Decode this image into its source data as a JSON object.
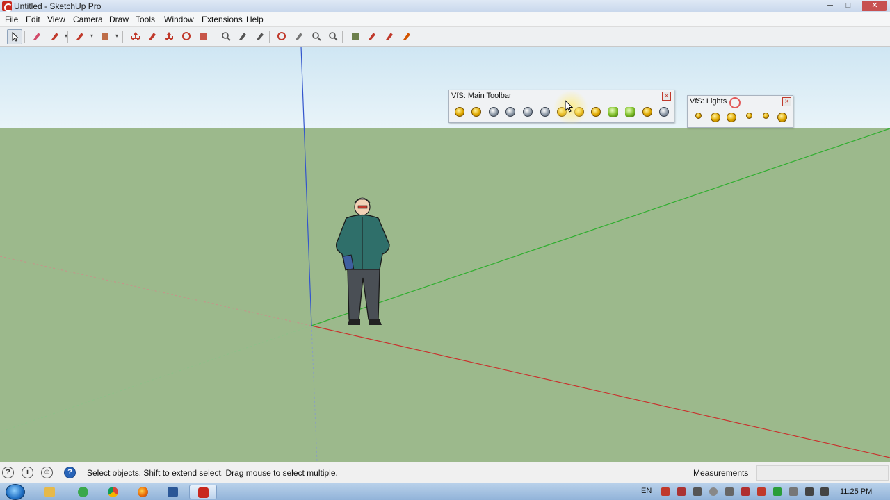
{
  "window": {
    "title": "Untitled - SketchUp Pro",
    "min_label": "─",
    "max_label": "□",
    "close_label": "✕"
  },
  "menu": [
    "File",
    "Edit",
    "View",
    "Camera",
    "Draw",
    "Tools",
    "Window",
    "Extensions",
    "Help"
  ],
  "toolbar": {
    "tools": [
      {
        "name": "select-icon",
        "color": "#222222"
      },
      {
        "name": "eraser-icon",
        "color": "#d24a6a"
      },
      {
        "name": "pencil-icon",
        "color": "#c0392b"
      },
      {
        "name": "arc-icon",
        "color": "#c0392b"
      },
      {
        "name": "rectangle-icon",
        "color": "#b5562c"
      },
      {
        "name": "push-pull-icon",
        "color": "#c0392b"
      },
      {
        "name": "follow-me-icon",
        "color": "#c0392b"
      },
      {
        "name": "move-icon",
        "color": "#c0392b"
      },
      {
        "name": "rotate-icon",
        "color": "#c0392b"
      },
      {
        "name": "scale-icon",
        "color": "#c0392b"
      },
      {
        "name": "tape-measure-icon",
        "color": "#555555"
      },
      {
        "name": "text-icon",
        "color": "#555555"
      },
      {
        "name": "paint-bucket-icon",
        "color": "#555555"
      },
      {
        "name": "orbit-icon",
        "color": "#c0392b"
      },
      {
        "name": "pan-icon",
        "color": "#777777"
      },
      {
        "name": "zoom-icon",
        "color": "#555555"
      },
      {
        "name": "zoom-extents-icon",
        "color": "#555555"
      },
      {
        "name": "warehouse-icon",
        "color": "#556b2f"
      },
      {
        "name": "share-model-icon",
        "color": "#c0392b"
      },
      {
        "name": "share-component-icon",
        "color": "#c0392b"
      },
      {
        "name": "extension-warehouse-icon",
        "color": "#d35400"
      }
    ]
  },
  "vfs_main": {
    "title": "VfS: Main Toolbar",
    "icons": [
      {
        "name": "vray-options-icon",
        "kind": "gold"
      },
      {
        "name": "material-editor-icon",
        "kind": "gold"
      },
      {
        "name": "render-icon",
        "kind": "grey"
      },
      {
        "name": "render-rt-icon",
        "kind": "grey"
      },
      {
        "name": "batch-render-icon",
        "kind": "grey"
      },
      {
        "name": "help-icon",
        "kind": "grey"
      },
      {
        "name": "frame-buffer-icon",
        "kind": "gold"
      },
      {
        "name": "light-gen-icon",
        "kind": "gold"
      },
      {
        "name": "export-icon",
        "kind": "gold"
      },
      {
        "name": "proxy-import-icon",
        "kind": "green"
      },
      {
        "name": "proxy-export-icon",
        "kind": "green"
      },
      {
        "name": "infinite-plane-icon",
        "kind": "gold"
      },
      {
        "name": "pause-icon",
        "kind": "grey"
      }
    ]
  },
  "vfs_lights": {
    "title": "VfS: Lights",
    "icons": [
      {
        "name": "omni-light-icon",
        "kind": "gold"
      },
      {
        "name": "rect-light-icon",
        "kind": "gold"
      },
      {
        "name": "spot-light-icon",
        "kind": "gold"
      },
      {
        "name": "ies-light-icon",
        "kind": "gold"
      },
      {
        "name": "sphere-light-icon",
        "kind": "gold"
      },
      {
        "name": "dome-light-icon",
        "kind": "gold"
      }
    ]
  },
  "status": {
    "hint": "Select objects. Shift to extend select. Drag mouse to select multiple.",
    "measurements_label": "Measurements",
    "measurements_value": ""
  },
  "taskbar": {
    "language": "EN",
    "clock": "11:25 PM"
  }
}
